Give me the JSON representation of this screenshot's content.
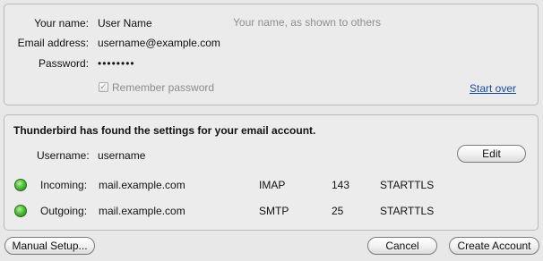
{
  "account_form": {
    "name_label": "Your name:",
    "name_value": "User Name",
    "name_hint": "Your name, as shown to others",
    "email_label": "Email address:",
    "email_value": "username@example.com",
    "password_label": "Password:",
    "password_value": "••••••••",
    "remember_label": "Remember password",
    "remember_checked": true,
    "start_over_link": "Start over"
  },
  "settings": {
    "heading": "Thunderbird has found the settings for your email account.",
    "username_label": "Username:",
    "username_value": "username",
    "edit_button": "Edit",
    "servers": [
      {
        "status": "ok",
        "status_color": "#3cb52e",
        "label": "Incoming:",
        "host": "mail.example.com",
        "protocol": "IMAP",
        "port": "143",
        "security": "STARTTLS"
      },
      {
        "status": "ok",
        "status_color": "#3cb52e",
        "label": "Outgoing:",
        "host": "mail.example.com",
        "protocol": "SMTP",
        "port": "25",
        "security": "STARTTLS"
      }
    ]
  },
  "footer": {
    "manual_setup_button": "Manual Setup...",
    "cancel_button": "Cancel",
    "create_account_button": "Create Account"
  }
}
